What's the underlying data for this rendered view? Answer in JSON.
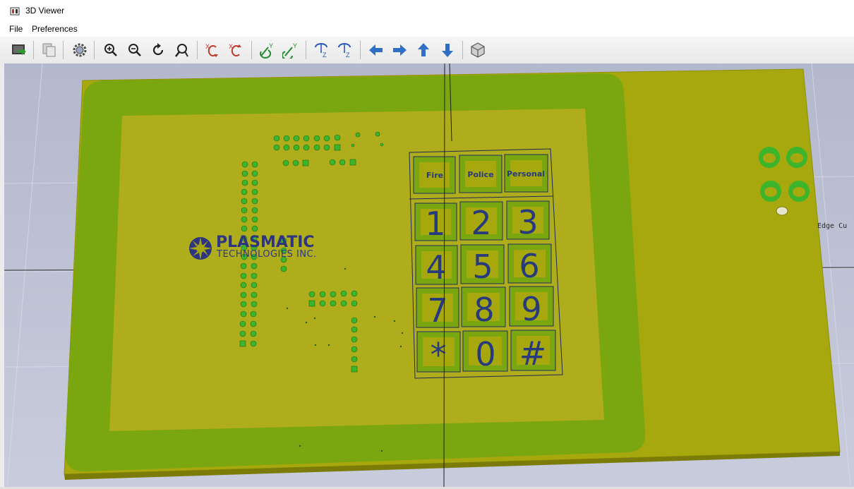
{
  "window": {
    "title": "3D Viewer"
  },
  "menu": {
    "items": [
      "File",
      "Preferences"
    ]
  },
  "toolbar": {
    "buttons": [
      {
        "name": "reload-board-icon"
      },
      {
        "name": "copy-image-icon"
      },
      {
        "name": "settings-icon"
      },
      {
        "name": "zoom-in-icon"
      },
      {
        "name": "zoom-out-icon"
      },
      {
        "name": "redraw-icon"
      },
      {
        "name": "zoom-fit-icon"
      },
      {
        "name": "rotate-x-cw-icon",
        "axis": "X"
      },
      {
        "name": "rotate-x-ccw-icon",
        "axis": "X"
      },
      {
        "name": "rotate-y-cw-icon",
        "axis": "Y"
      },
      {
        "name": "rotate-y-ccw-icon",
        "axis": "Y"
      },
      {
        "name": "rotate-z-cw-icon",
        "axis": "Z"
      },
      {
        "name": "rotate-z-ccw-icon",
        "axis": "Z"
      },
      {
        "name": "move-left-icon"
      },
      {
        "name": "move-right-icon"
      },
      {
        "name": "move-up-icon"
      },
      {
        "name": "move-down-icon"
      },
      {
        "name": "ortho-view-icon"
      }
    ]
  },
  "board": {
    "logo_text": "PLASMATIC",
    "logo_subtext": "TECHNOLOGIES INC.",
    "edge_label": "Edge Cu",
    "keypad": {
      "function_keys": [
        "Fire",
        "Police",
        "Personal"
      ],
      "keys": [
        "1",
        "2",
        "3",
        "4",
        "5",
        "6",
        "7",
        "8",
        "9",
        "*",
        "0",
        "#"
      ]
    },
    "colors": {
      "board": "#a7a80e",
      "copper_ring": "#7aa60f",
      "inner_fill": "#b0ad1c",
      "silk": "#283a7e",
      "pad": "#3cb42c"
    }
  }
}
